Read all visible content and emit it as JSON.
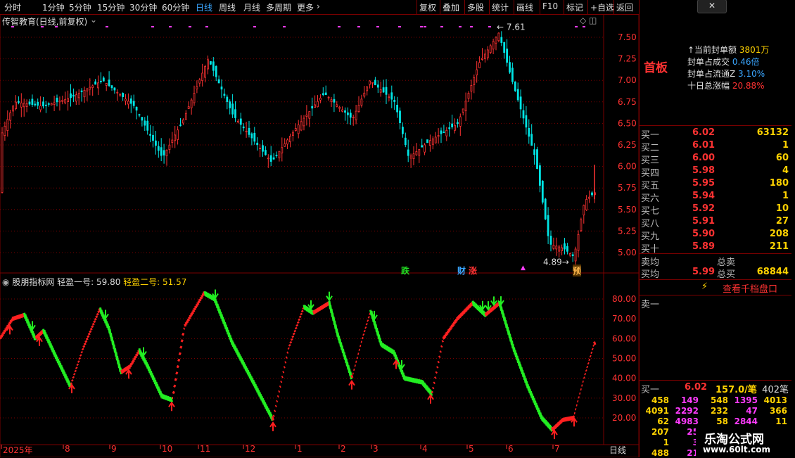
{
  "toolbar": {
    "periods": [
      "分时",
      "1分钟",
      "5分钟",
      "15分钟",
      "30分钟",
      "60分钟",
      "日线",
      "周线",
      "月线",
      "多周期",
      "更多"
    ],
    "active_period": "日线",
    "buttons": [
      "复权",
      "叠加",
      "多股",
      "统计",
      "画线",
      "F10",
      "标记",
      "+自选",
      "返回"
    ]
  },
  "chart": {
    "title": "传智教育(日线,前复权)",
    "price_ticks": [
      "7.50",
      "7.25",
      "7.00",
      "6.75",
      "6.50",
      "6.25",
      "6.00",
      "5.75",
      "5.50",
      "5.25",
      "5.00"
    ],
    "high_label": "7.61",
    "low_label": "4.89",
    "event_labels": [
      "跌",
      "财",
      "涨",
      "预"
    ],
    "indicator_name": "股朋指标网",
    "indicator_line1": "轻盈一号: 59.80",
    "indicator_line2": "轻盈二号: 51.57",
    "indicator_ticks": [
      "80.00",
      "70.00",
      "60.00",
      "50.00",
      "40.00",
      "30.00",
      "20.00"
    ],
    "date_labels": [
      "2025年",
      "8",
      "9",
      "10",
      "11",
      "12",
      "1",
      "2",
      "3",
      "4",
      "5",
      "6",
      "7"
    ],
    "period_label": "日线"
  },
  "colors": {
    "up": "#ff3232",
    "down": "#00e5e5",
    "ind_up": "#ff2020",
    "ind_down": "#22ee22",
    "grid": "#7a0000",
    "accent": "#ffd200"
  },
  "panel": {
    "title": "首板",
    "stats": [
      {
        "label": "当前封单额",
        "value": "3801万"
      },
      {
        "label": "封单占成交",
        "value": "0.46倍"
      },
      {
        "label": "封单占流通Z",
        "value": "3.10%"
      },
      {
        "label": "十日总涨幅",
        "value": "20.88%"
      }
    ],
    "bids": [
      {
        "name": "买一",
        "price": "6.02",
        "vol": "63132"
      },
      {
        "name": "买二",
        "price": "6.01",
        "vol": "1"
      },
      {
        "name": "买三",
        "price": "6.00",
        "vol": "60"
      },
      {
        "name": "买四",
        "price": "5.98",
        "vol": "4"
      },
      {
        "name": "买五",
        "price": "5.95",
        "vol": "180"
      },
      {
        "name": "买六",
        "price": "5.94",
        "vol": "1"
      },
      {
        "name": "买七",
        "price": "5.92",
        "vol": "10"
      },
      {
        "name": "买八",
        "price": "5.91",
        "vol": "27"
      },
      {
        "name": "买九",
        "price": "5.90",
        "vol": "208"
      },
      {
        "name": "买十",
        "price": "5.89",
        "vol": "211"
      }
    ],
    "sell_avg_label": "卖均",
    "total_sell_label": "总卖",
    "buy_avg_label": "买均",
    "buy_avg_price": "5.99",
    "total_buy_label": "总买",
    "total_buy_vol": "68844",
    "view_ten_levels": "查看千档盘口",
    "sell1_label": "卖一",
    "bottom_buy1": "买一",
    "bottom_price": "6.02",
    "bottom_amount": "157.0/笔",
    "bottom_count": "402笔",
    "queue": [
      [
        "458",
        "149",
        "548",
        "1395",
        "4013"
      ],
      [
        "4091",
        "2292",
        "232",
        "47",
        "366"
      ],
      [
        "62",
        "4983",
        "58",
        "2844",
        "11"
      ],
      [
        "207",
        "25",
        "",
        "",
        ""
      ],
      [
        "1",
        "3",
        "",
        "",
        ""
      ],
      [
        "488",
        "21",
        "",
        "",
        ""
      ]
    ],
    "watermark_title": "乐淘公式网",
    "watermark_url": "www.60lt.com"
  }
}
